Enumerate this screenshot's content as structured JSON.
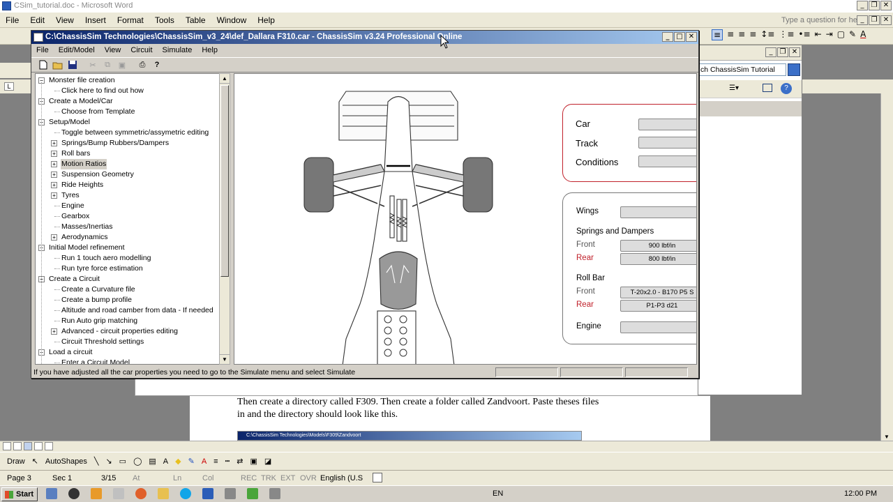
{
  "word": {
    "title": "CSim_tutorial.doc - Microsoft Word",
    "menu": [
      "File",
      "Edit",
      "View",
      "Insert",
      "Format",
      "Tools",
      "Table",
      "Window",
      "Help"
    ],
    "ask_placeholder": "Type a question for help",
    "doc_text_line1": "Then create a directory called F309. Then create a folder called Zandvoort. Paste theses files",
    "doc_text_line2": "in and the directory should look like this.",
    "embedded_title": "C:\\ChassisSim Technologies\\Models\\F309\\Zandvoort",
    "draw_label": "Draw",
    "autoshapes_label": "AutoShapes",
    "status": {
      "page": "Page  3",
      "sec": "Sec  1",
      "pages": "3/15",
      "at": "At",
      "ln": "Ln",
      "col": "Col",
      "rec": "REC",
      "trk": "TRK",
      "ext": "EXT",
      "ovr": "OVR",
      "lang": "English (U.S"
    }
  },
  "help_pane": {
    "search_value": "ch ChassisSim Tutorial"
  },
  "chassissim": {
    "title": "C:\\ChassisSim Technologies\\ChassisSim_v3_24\\def_Dallara F310.car - ChassisSim v3.24 Professional Online",
    "menu": [
      "File",
      "Edit/Model",
      "View",
      "Circuit",
      "Simulate",
      "Help"
    ],
    "tree": [
      {
        "label": "Monster file creation",
        "level": 0
      },
      {
        "label": "Click here to find out how",
        "level": 1
      },
      {
        "label": "Create a Model/Car",
        "level": 0
      },
      {
        "label": "Choose from Template",
        "level": 1
      },
      {
        "label": "Setup/Model",
        "level": 0
      },
      {
        "label": "Toggle between symmetric/assymetric editing",
        "level": 1
      },
      {
        "label": "Springs/Bump Rubbers/Dampers",
        "level": 1,
        "plus": true
      },
      {
        "label": "Roll bars",
        "level": 1,
        "plus": true
      },
      {
        "label": "Motion Ratios",
        "level": 1,
        "plus": true,
        "selected": true
      },
      {
        "label": "Suspension Geometry",
        "level": 1,
        "plus": true
      },
      {
        "label": "Ride Heights",
        "level": 1,
        "plus": true
      },
      {
        "label": "Tyres",
        "level": 1,
        "plus": true
      },
      {
        "label": "Engine",
        "level": 1
      },
      {
        "label": "Gearbox",
        "level": 1
      },
      {
        "label": "Masses/Inertias",
        "level": 1
      },
      {
        "label": "Aerodynamics",
        "level": 1,
        "plus": true
      },
      {
        "label": "Initial Model refinement",
        "level": 0
      },
      {
        "label": "Run 1 touch aero modelling",
        "level": 1
      },
      {
        "label": "Run tyre force estimation",
        "level": 1
      },
      {
        "label": "Create a Circuit",
        "level": 0
      },
      {
        "label": "Create a Curvature file",
        "level": 1
      },
      {
        "label": "Create a bump profile",
        "level": 1
      },
      {
        "label": "Altitude and road camber from data - If needed",
        "level": 1
      },
      {
        "label": "Run Auto grip matching",
        "level": 1
      },
      {
        "label": "Advanced - circuit properties editing",
        "level": 1,
        "plus": true
      },
      {
        "label": "Circuit Threshold settings",
        "level": 1
      },
      {
        "label": "Load a circuit",
        "level": 0
      },
      {
        "label": "Enter a Circuit Model",
        "level": 1
      }
    ],
    "status_text": "If you have adjusted all the car properties you need to go to the Simulate menu and select Simulate",
    "panel1": {
      "car": "Car",
      "track": "Track",
      "conditions": "Conditions"
    },
    "panel2": {
      "wings": "Wings",
      "springs": "Springs and Dampers",
      "front": "Front",
      "rear": "Rear",
      "front_spring": "900 lbf/in",
      "rear_spring": "800 lbf/in",
      "rollbar": "Roll Bar",
      "rb_front": "Front",
      "rb_rear": "Rear",
      "rb_front_val": "T-20x2.0 - B170 P5 S",
      "rb_rear_val": "P1-P3 d21",
      "engine": "Engine"
    }
  },
  "taskbar": {
    "start": "Start",
    "lang": "EN",
    "clock": "12:00 PM"
  }
}
